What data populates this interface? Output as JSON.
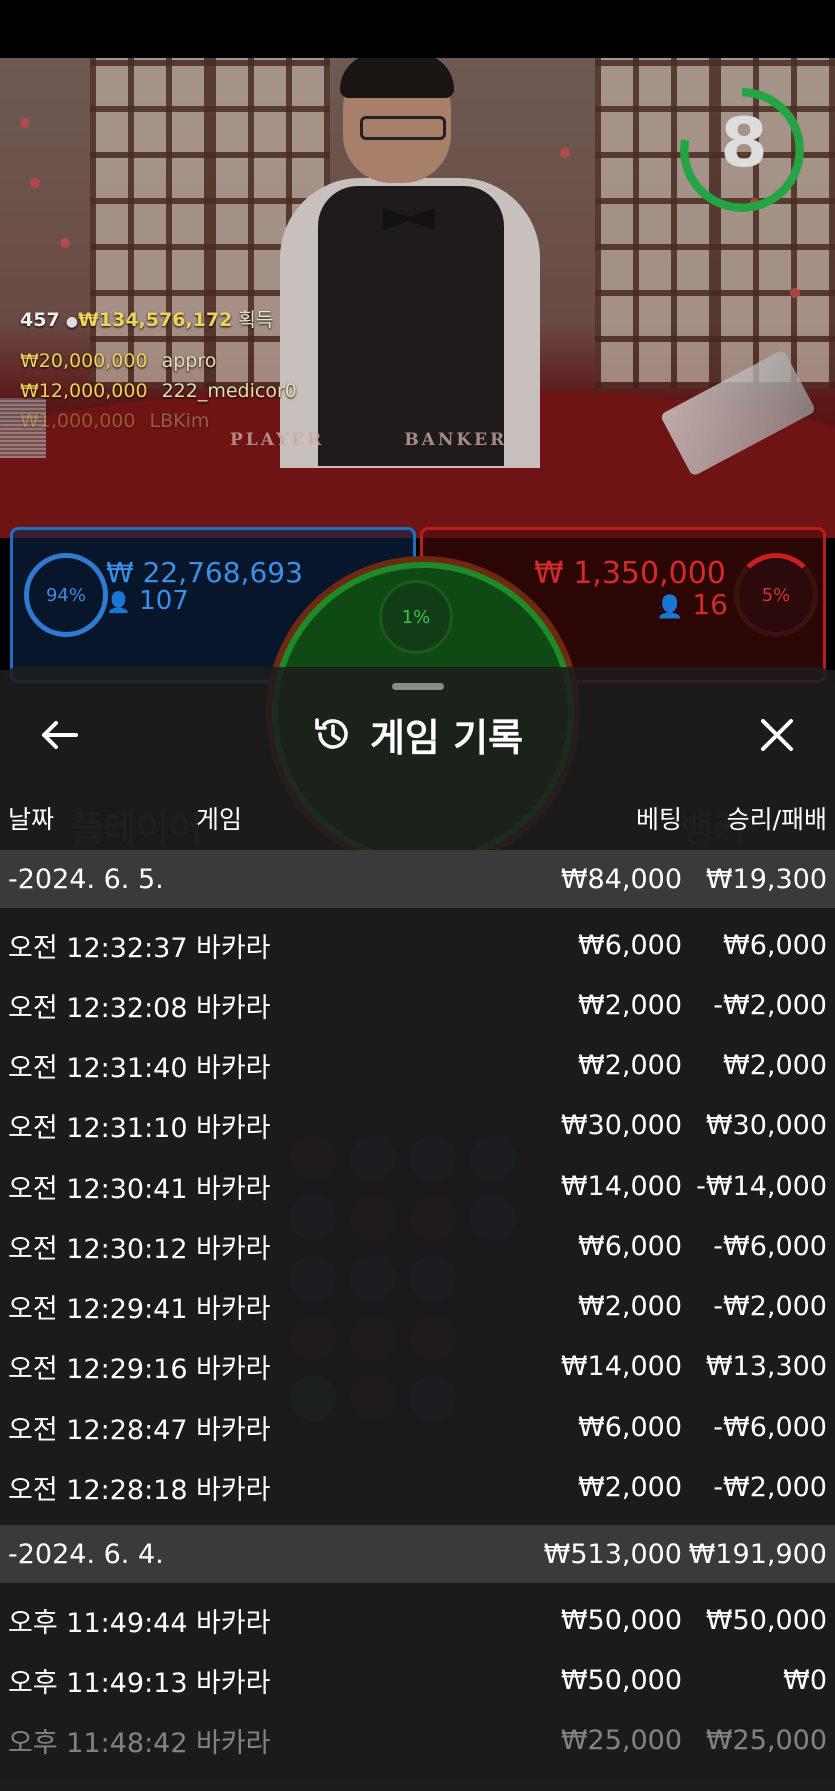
{
  "video": {
    "timer": "8",
    "felt_player": "PLAYER",
    "felt_banker": "BANKER",
    "stats": {
      "count": "457",
      "total": "₩134,576,172",
      "label": "획득"
    },
    "winners": [
      {
        "amount": "₩20,000,000",
        "name": "appro"
      },
      {
        "amount": "₩12,000,000",
        "name": "222_medicor0"
      },
      {
        "amount": "₩1,000,000",
        "name": "LBKim"
      }
    ]
  },
  "bets": {
    "player": {
      "pct": "94%",
      "amount": "₩ 22,768,693",
      "count": "107"
    },
    "tie": {
      "pct": "1%"
    },
    "banker": {
      "pct": "5%",
      "amount": "₩ 1,350,000",
      "count": "16"
    }
  },
  "colors": {
    "player": "#1e6fc2",
    "banker": "#b81c1c",
    "tie": "#1f8a2a",
    "timer": "#23a544",
    "group_bg": "#3a3a3a"
  },
  "sheet": {
    "title": "게임 기록",
    "icons": {
      "back": "arrow-left-icon",
      "history": "history-icon",
      "close": "close-icon"
    },
    "columns": {
      "date": "날짜",
      "game": "게임",
      "bet": "베팅",
      "result": "승리/패배"
    },
    "groups": [
      {
        "date": "-2024. 6. 5.",
        "bet": "₩84,000",
        "result": "₩19,300",
        "rows": [
          {
            "time": "오전 12:32:37",
            "game": "바카라",
            "bet": "₩6,000",
            "result": "₩6,000"
          },
          {
            "time": "오전 12:32:08",
            "game": "바카라",
            "bet": "₩2,000",
            "result": "-₩2,000"
          },
          {
            "time": "오전 12:31:40",
            "game": "바카라",
            "bet": "₩2,000",
            "result": "₩2,000"
          },
          {
            "time": "오전 12:31:10",
            "game": "바카라",
            "bet": "₩30,000",
            "result": "₩30,000"
          },
          {
            "time": "오전 12:30:41",
            "game": "바카라",
            "bet": "₩14,000",
            "result": "-₩14,000"
          },
          {
            "time": "오전 12:30:12",
            "game": "바카라",
            "bet": "₩6,000",
            "result": "-₩6,000"
          },
          {
            "time": "오전 12:29:41",
            "game": "바카라",
            "bet": "₩2,000",
            "result": "-₩2,000"
          },
          {
            "time": "오전 12:29:16",
            "game": "바카라",
            "bet": "₩14,000",
            "result": "₩13,300"
          },
          {
            "time": "오전 12:28:47",
            "game": "바카라",
            "bet": "₩6,000",
            "result": "-₩6,000"
          },
          {
            "time": "오전 12:28:18",
            "game": "바카라",
            "bet": "₩2,000",
            "result": "-₩2,000"
          }
        ]
      },
      {
        "date": "-2024. 6. 4.",
        "bet": "₩513,000",
        "result": "₩191,900",
        "rows": [
          {
            "time": "오후 11:49:44",
            "game": "바카라",
            "bet": "₩50,000",
            "result": "₩50,000"
          },
          {
            "time": "오후 11:49:13",
            "game": "바카라",
            "bet": "₩50,000",
            "result": "₩0"
          },
          {
            "time": "오후 11:48:42",
            "game": "바카라",
            "bet": "₩25,000",
            "result": "₩25,000"
          }
        ]
      }
    ]
  }
}
